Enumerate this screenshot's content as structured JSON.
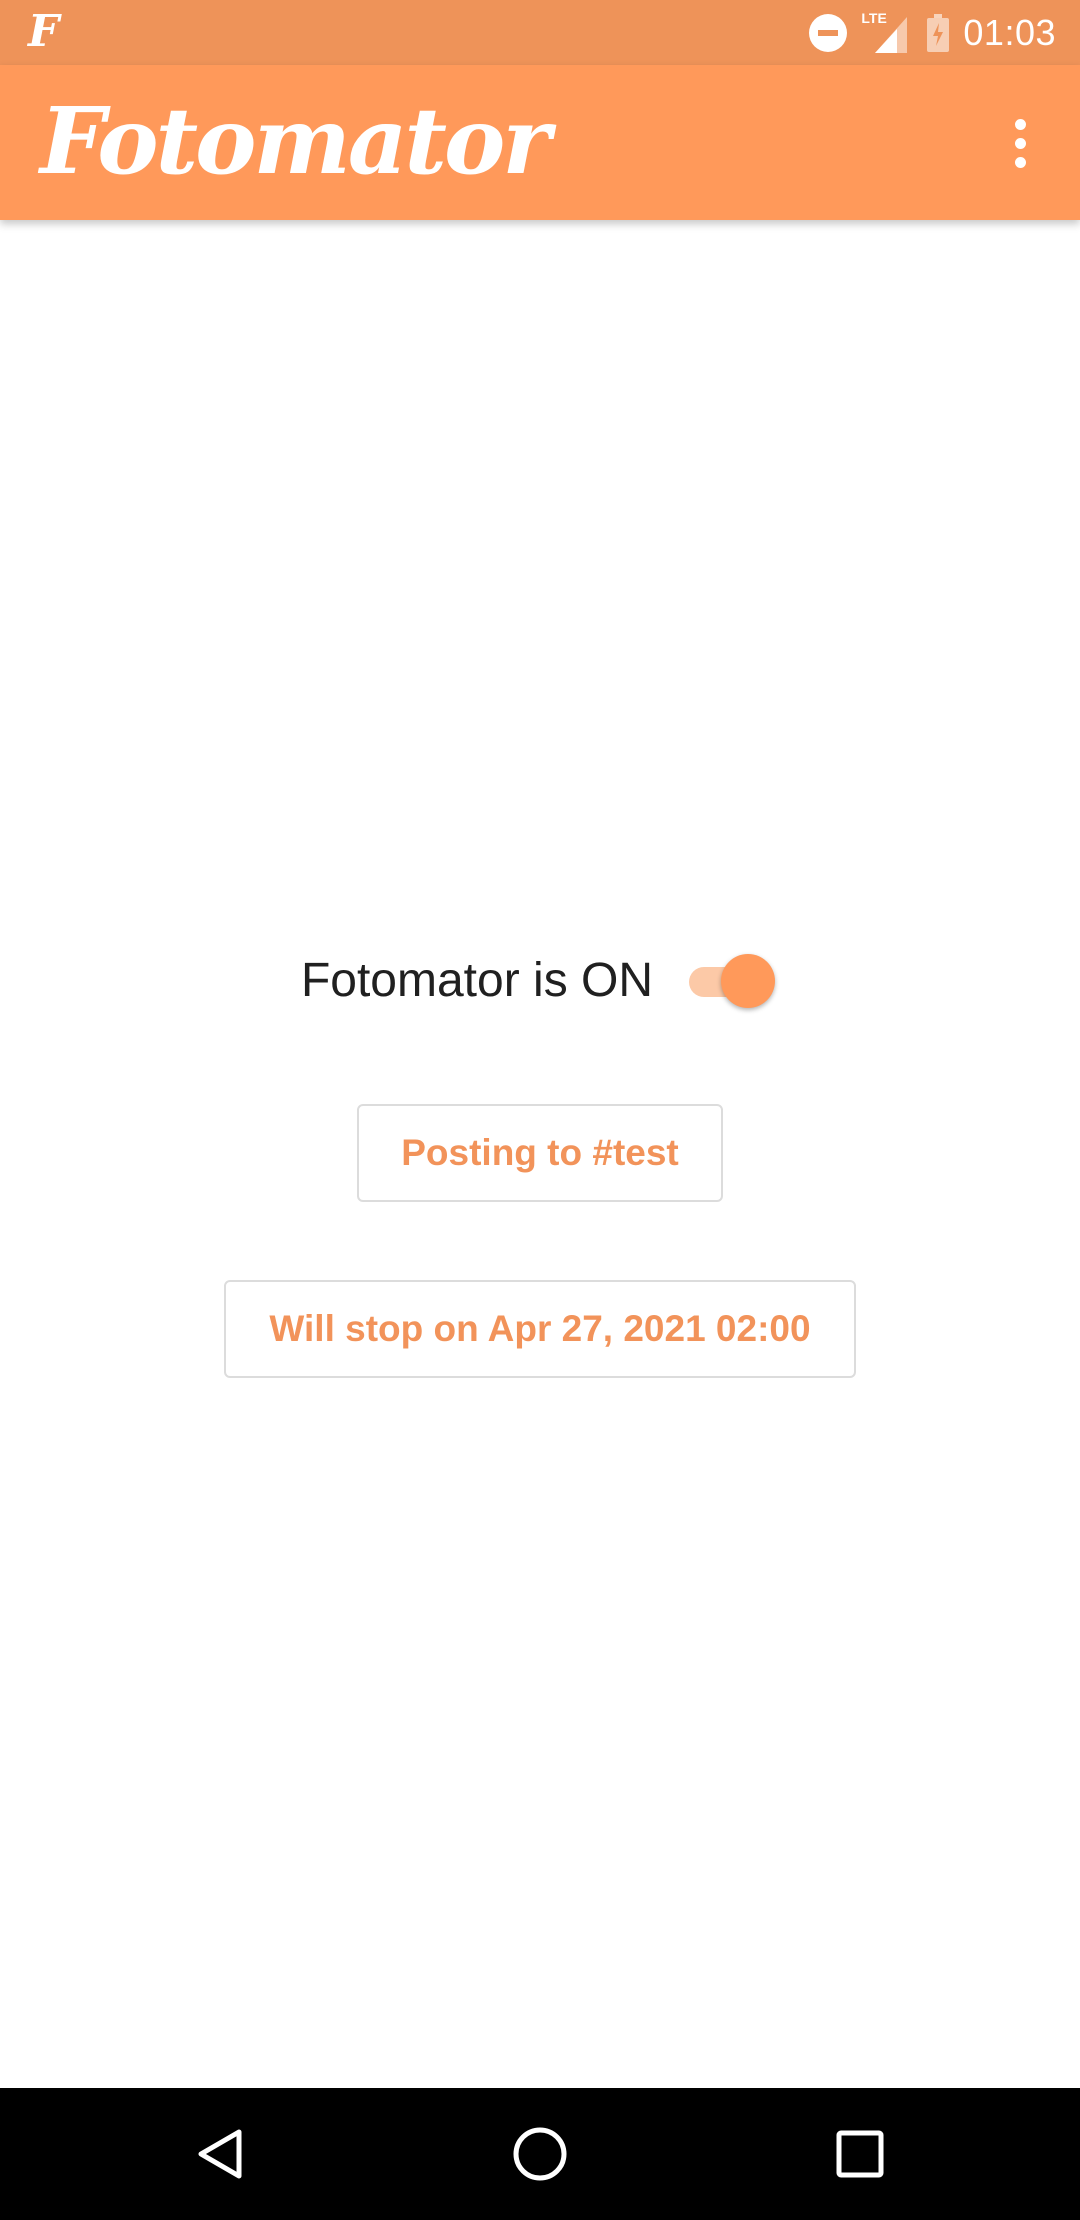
{
  "status_bar": {
    "app_icon_glyph": "F",
    "network_label": "LTE",
    "time": "01:03"
  },
  "app_bar": {
    "title": "Fotomator"
  },
  "main": {
    "toggle_label": "Fotomator is ON",
    "toggle_state": "on",
    "hashtag_button": "Posting to #test",
    "stop_button": "Will stop on Apr 27, 2021 02:00"
  },
  "colors": {
    "status_bar_bg": "#ee9359",
    "app_bar_bg": "#ff995a",
    "accent": "#ff995a",
    "switch_track": "#fcc9a7",
    "button_text": "#f2935a",
    "nav_bar_bg": "#000000"
  },
  "icons": {
    "status": [
      "app-notification-icon",
      "do-not-disturb-icon",
      "lte-signal-icon",
      "battery-charging-icon"
    ],
    "app_bar": [
      "overflow-menu-icon"
    ],
    "nav": [
      "back-icon",
      "home-icon",
      "recents-icon"
    ]
  }
}
